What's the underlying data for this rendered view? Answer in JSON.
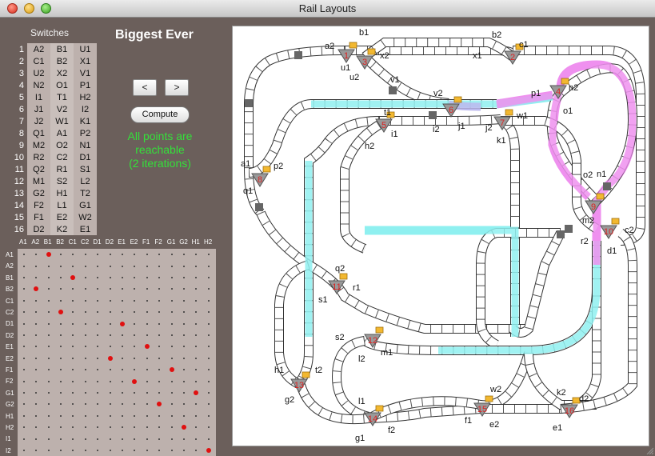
{
  "window": {
    "title": "Rail Layouts"
  },
  "switches_panel": {
    "title": "Switches",
    "rows": [
      {
        "n": "1",
        "a": "A2",
        "b": "B1",
        "c": "U1"
      },
      {
        "n": "2",
        "a": "C1",
        "b": "B2",
        "c": "X1"
      },
      {
        "n": "3",
        "a": "U2",
        "b": "X2",
        "c": "V1"
      },
      {
        "n": "4",
        "a": "N2",
        "b": "O1",
        "c": "P1"
      },
      {
        "n": "5",
        "a": "I1",
        "b": "T1",
        "c": "H2"
      },
      {
        "n": "6",
        "a": "J1",
        "b": "V2",
        "c": "I2"
      },
      {
        "n": "7",
        "a": "J2",
        "b": "W1",
        "c": "K1"
      },
      {
        "n": "8",
        "a": "Q1",
        "b": "A1",
        "c": "P2"
      },
      {
        "n": "9",
        "a": "M2",
        "b": "O2",
        "c": "N1"
      },
      {
        "n": "10",
        "a": "R2",
        "b": "C2",
        "c": "D1"
      },
      {
        "n": "11",
        "a": "Q2",
        "b": "R1",
        "c": "S1"
      },
      {
        "n": "12",
        "a": "M1",
        "b": "S2",
        "c": "L2"
      },
      {
        "n": "13",
        "a": "G2",
        "b": "H1",
        "c": "T2"
      },
      {
        "n": "14",
        "a": "F2",
        "b": "L1",
        "c": "G1"
      },
      {
        "n": "15",
        "a": "F1",
        "b": "E2",
        "c": "W2"
      },
      {
        "n": "16",
        "a": "D2",
        "b": "K2",
        "c": "E1"
      }
    ]
  },
  "layout": {
    "name": "Biggest Ever"
  },
  "nav": {
    "prev_label": "<",
    "next_label": ">"
  },
  "compute": {
    "label": "Compute"
  },
  "status": {
    "line1": "All points are",
    "line2": "reachable",
    "line3": "(2 iterations)",
    "color": "#34e03a"
  },
  "matrix": {
    "columns": [
      "A1",
      "A2",
      "B1",
      "B2",
      "C1",
      "C2",
      "D1",
      "D2",
      "E1",
      "E2",
      "F1",
      "F2",
      "G1",
      "G2",
      "H1",
      "H2"
    ],
    "rows": [
      "A1",
      "A2",
      "B1",
      "B2",
      "C1",
      "C2",
      "D1",
      "D2",
      "E1",
      "E2",
      "F1",
      "F2",
      "G1",
      "G2",
      "H1",
      "H2",
      "I1",
      "I2"
    ],
    "reachable": [
      [
        0,
        2
      ],
      [
        2,
        4
      ],
      [
        3,
        1
      ],
      [
        5,
        3
      ],
      [
        6,
        8
      ],
      [
        8,
        10
      ],
      [
        9,
        7
      ],
      [
        10,
        12
      ],
      [
        11,
        9
      ],
      [
        12,
        14
      ],
      [
        13,
        11
      ],
      [
        15,
        13
      ],
      [
        17,
        15
      ]
    ],
    "dot_color": "#e01010"
  },
  "track": {
    "route_colors": {
      "cyan": "#8ff0f0",
      "magenta": "#ee90ee"
    },
    "switch_labels": [
      "1",
      "2",
      "3",
      "4",
      "5",
      "6",
      "7",
      "8",
      "9",
      "10",
      "11",
      "12",
      "13",
      "14",
      "15",
      "16"
    ],
    "point_labels": [
      "a1",
      "a2",
      "b1",
      "b2",
      "c1",
      "c2",
      "d1",
      "d2",
      "e1",
      "e2",
      "f1",
      "f2",
      "g1",
      "g2",
      "h1",
      "h2",
      "i1",
      "i2",
      "j1",
      "j2",
      "k1",
      "k2",
      "l1",
      "l2",
      "m1",
      "m2",
      "n1",
      "n2",
      "o1",
      "o2",
      "p1",
      "p2",
      "q1",
      "q2",
      "r1",
      "r2",
      "s1",
      "s2",
      "t1",
      "t2",
      "u1",
      "u2",
      "v1",
      "v2",
      "w1",
      "w2",
      "x1",
      "x2"
    ]
  }
}
